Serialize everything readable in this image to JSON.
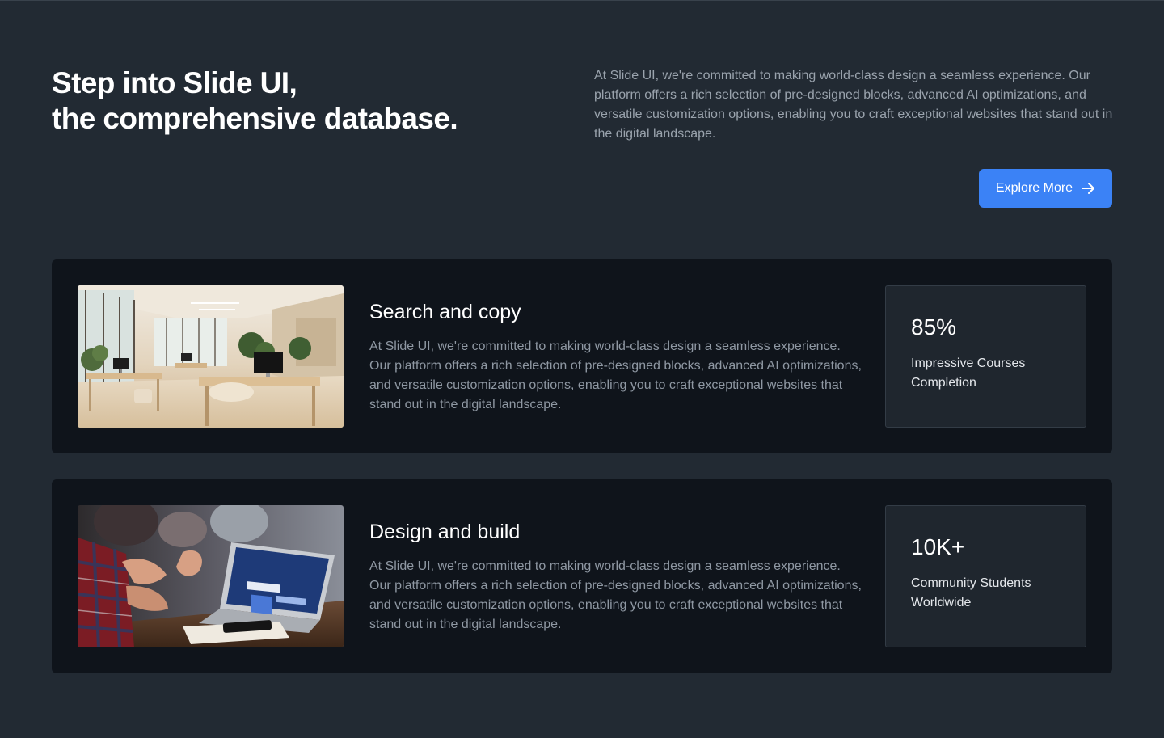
{
  "hero": {
    "title_line1": "Step into Slide UI,",
    "title_line2": "the comprehensive database.",
    "description": "At Slide UI, we're committed to making world-class design a seamless experience. Our platform offers a rich selection of pre-designed blocks, advanced AI optimizations, and versatile customization options, enabling you to craft exceptional websites that stand out in the digital landscape.",
    "cta_label": "Explore More",
    "cta_icon": "arrow-right-icon"
  },
  "features": [
    {
      "title": "Search and copy",
      "text": "At Slide UI, we're committed to making world-class design a seamless experience. Our platform offers a rich selection of pre-designed blocks, advanced AI optimizations, and versatile customization options, enabling you to craft exceptional websites that stand out in the digital landscape.",
      "image": "office-interior-photo",
      "stat_value": "85%",
      "stat_label": "Impressive Courses Completion"
    },
    {
      "title": "Design and build",
      "text": "At Slide UI, we're committed to making world-class design a seamless experience. Our platform offers a rich selection of pre-designed blocks, advanced AI optimizations, and versatile customization options, enabling you to craft exceptional websites that stand out in the digital landscape.",
      "image": "laptop-meeting-photo",
      "stat_value": "10K+",
      "stat_label": "Community Students Worldwide"
    }
  ],
  "colors": {
    "page_background": "#222a33",
    "card_background": "#0f141b",
    "stat_background": "#1f262e",
    "accent": "#3b82f6",
    "heading": "#ffffff",
    "body_text": "#9aa3ad"
  }
}
